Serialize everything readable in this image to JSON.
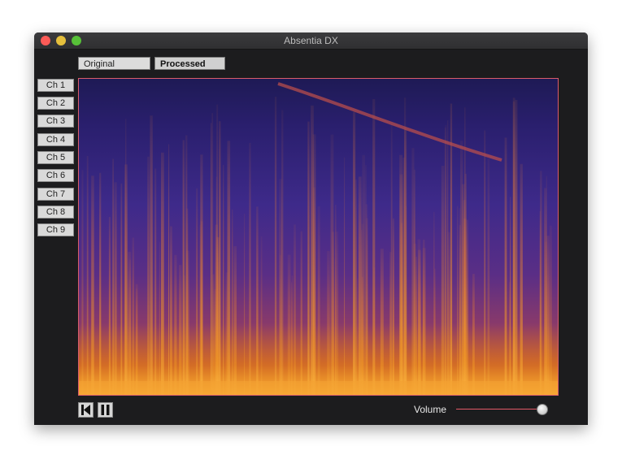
{
  "window": {
    "title": "Absentia DX",
    "traffic_lights": [
      "close",
      "minimize",
      "zoom"
    ]
  },
  "view_toggle": {
    "original_label": "Original",
    "processed_label": "Processed",
    "selected": "Processed"
  },
  "channels": [
    "Ch 1",
    "Ch 2",
    "Ch 3",
    "Ch 4",
    "Ch 5",
    "Ch 6",
    "Ch 7",
    "Ch 8",
    "Ch 9"
  ],
  "selected_channel": "Ch 1",
  "spectrogram": {
    "colormap": "inferno-style (dark purple to orange/yellow)",
    "border_color": "#d95c6a"
  },
  "transport": {
    "rewind_icon": "skip-to-start-icon",
    "pause_icon": "pause-icon"
  },
  "volume": {
    "label": "Volume",
    "level": 0.98
  }
}
